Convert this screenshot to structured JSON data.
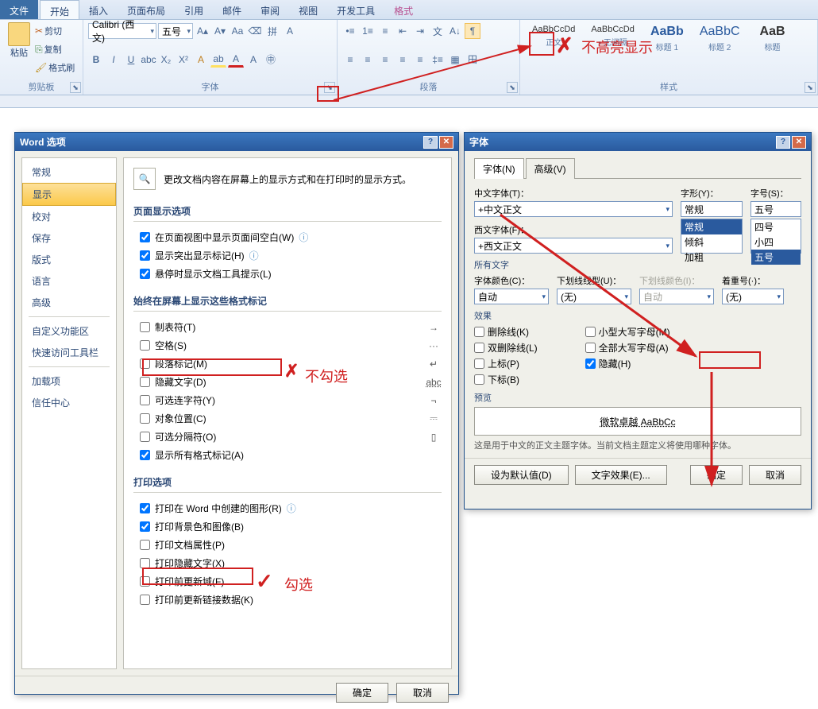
{
  "ribbon": {
    "tabs": [
      "文件",
      "开始",
      "插入",
      "页面布局",
      "引用",
      "邮件",
      "审阅",
      "视图",
      "开发工具",
      "格式"
    ],
    "clipboard": {
      "label": "剪贴板",
      "cut": "剪切",
      "copy": "复制",
      "paint": "格式刷",
      "paste": "粘贴"
    },
    "font": {
      "label": "字体",
      "family": "Calibri (西文)",
      "size": "五号"
    },
    "para": {
      "label": "段落"
    },
    "styles": {
      "label": "样式",
      "items": [
        {
          "preview": "AaBbCcDd",
          "name": "正文"
        },
        {
          "preview": "AaBbCcDd",
          "name": "• 无间隔"
        },
        {
          "preview": "AaBb",
          "name": "标题 1"
        },
        {
          "preview": "AaBbC",
          "name": "标题 2"
        },
        {
          "preview": "AaB",
          "name": "标题"
        }
      ]
    }
  },
  "options_dialog": {
    "title": "Word 选项",
    "nav": [
      "常规",
      "显示",
      "校对",
      "保存",
      "版式",
      "语言",
      "高级",
      "自定义功能区",
      "快速访问工具栏",
      "加载项",
      "信任中心"
    ],
    "header": "更改文档内容在屏幕上的显示方式和在打印时的显示方式。",
    "sec1": "页面显示选项",
    "c1": "在页面视图中显示页面间空白(W)",
    "c2": "显示突出显示标记(H)",
    "c3": "悬停时显示文档工具提示(L)",
    "sec2": "始终在屏幕上显示这些格式标记",
    "c4": "制表符(T)",
    "s4": "→",
    "c5": "空格(S)",
    "s5": "···",
    "c6": "段落标记(M)",
    "s6": "↵",
    "c7": "隐藏文字(D)",
    "s7": "abc",
    "c8": "可选连字符(Y)",
    "s8": "¬",
    "c9": "对象位置(C)",
    "s9": "⎓",
    "c10": "可选分隔符(O)",
    "s10": "▯",
    "c11": "显示所有格式标记(A)",
    "sec3": "打印选项",
    "c12": "打印在 Word 中创建的图形(R)",
    "c13": "打印背景色和图像(B)",
    "c14": "打印文档属性(P)",
    "c15": "打印隐藏文字(X)",
    "c16": "打印前更新域(F)",
    "c17": "打印前更新链接数据(K)",
    "ok": "确定",
    "cancel": "取消"
  },
  "font_dialog": {
    "title": "字体",
    "tab1": "字体(N)",
    "tab2": "高级(V)",
    "cn_label": "中文字体(T)：",
    "cn_val": "+中文正文",
    "wn_label": "西文字体(F)：",
    "wn_val": "+西文正文",
    "style_label": "字形(Y)：",
    "style_val": "常规",
    "style_opts": [
      "常规",
      "倾斜",
      "加粗"
    ],
    "size_label": "字号(S)：",
    "size_val": "五号",
    "size_opts": [
      "四号",
      "小四",
      "五号"
    ],
    "all_text": "所有文字",
    "color_label": "字体颜色(C)：",
    "color_val": "自动",
    "ul_label": "下划线线型(U)：",
    "ul_val": "(无)",
    "ulc_label": "下划线颜色(I)：",
    "ulc_val": "自动",
    "em_label": "着重号(·)：",
    "em_val": "(无)",
    "fx": "效果",
    "fx1": "删除线(K)",
    "fx2": "双删除线(L)",
    "fx3": "上标(P)",
    "fx4": "下标(B)",
    "fx5": "小型大写字母(M)",
    "fx6": "全部大写字母(A)",
    "fx7": "隐藏(H)",
    "preview": "预览",
    "preview_text": "微软卓越 AaBbCc",
    "preview_note": "这是用于中文的正文主题字体。当前文档主题定义将使用哪种字体。",
    "set_default": "设为默认值(D)",
    "text_fx": "文字效果(E)...",
    "ok": "确定",
    "cancel": "取消"
  },
  "annot": {
    "no_highlight": "不高亮显示",
    "no_check": "不勾选",
    "check": "勾选"
  }
}
